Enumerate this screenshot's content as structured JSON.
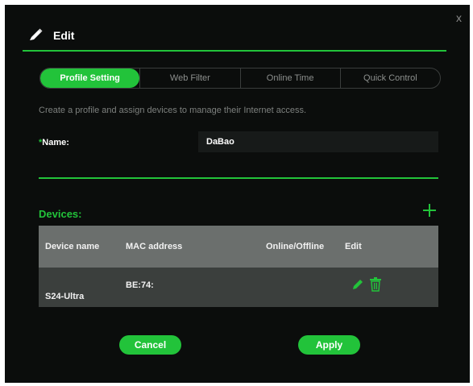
{
  "dialog": {
    "title": "Edit",
    "close_label": "x"
  },
  "tabs": [
    {
      "label": "Profile Setting",
      "active": true
    },
    {
      "label": "Web Filter",
      "active": false
    },
    {
      "label": "Online Time",
      "active": false
    },
    {
      "label": "Quick Control",
      "active": false
    }
  ],
  "description": "Create a profile and assign devices to manage their Internet access.",
  "name_field": {
    "required_mark": "*",
    "label": "Name:",
    "value": "DaBao"
  },
  "devices": {
    "label": "Devices:",
    "add_icon": "plus-icon",
    "columns": [
      "Device name",
      "MAC address",
      "Online/Offline",
      "Edit"
    ],
    "rows": [
      {
        "name": "S24-Ultra",
        "mac": "BE:74:",
        "status": "",
        "edit_icon": "pencil-icon",
        "delete_icon": "trash-icon"
      }
    ]
  },
  "buttons": {
    "cancel": "Cancel",
    "apply": "Apply"
  },
  "colors": {
    "accent": "#22c33a",
    "background": "#0b0d0c",
    "table_header": "#6b6f6d",
    "table_row": "#3b3f3d"
  }
}
